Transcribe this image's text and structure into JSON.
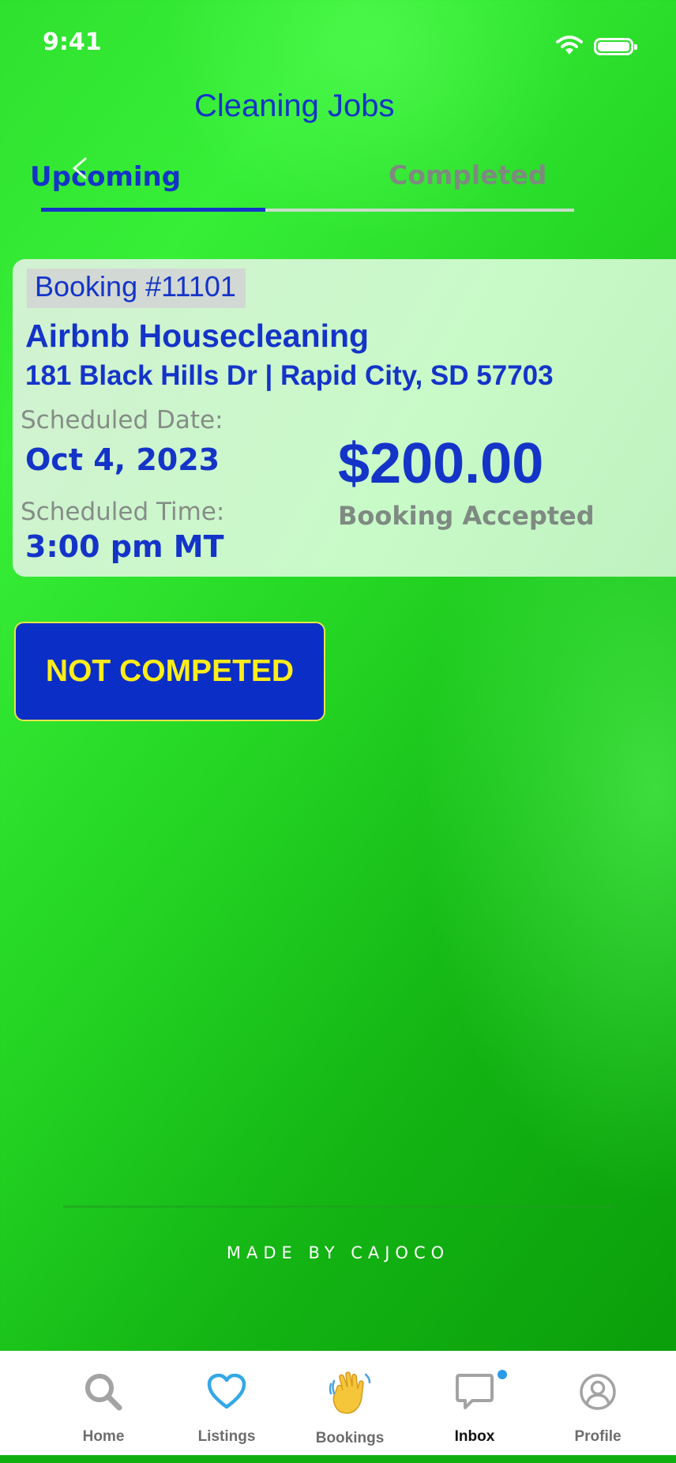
{
  "status_bar": {
    "time": "9:41",
    "icons": [
      "wifi-icon",
      "battery-icon"
    ]
  },
  "header": {
    "title": "Cleaning Jobs"
  },
  "tabs": [
    {
      "label": "Upcoming",
      "active": true
    },
    {
      "label": "Completed",
      "active": false
    }
  ],
  "booking": {
    "id_label": "Booking #11101",
    "title": "Airbnb Housecleaning",
    "address": "181 Black Hills Dr | Rapid City, SD 57703",
    "date_label": "Scheduled Date:",
    "date_value": "Oct 4, 2023",
    "time_label": "Scheduled Time:",
    "time_value": "3:00 pm MT",
    "price": "$200.00",
    "status": "Booking Accepted"
  },
  "status_button": {
    "label": "NOT COMPETED"
  },
  "footer": {
    "credit": "MADE BY CAJOCO"
  },
  "bottom_nav": [
    {
      "label": "Home",
      "icon": "search-icon",
      "active": false
    },
    {
      "label": "Listings",
      "icon": "heart-icon",
      "active": false
    },
    {
      "label": "Bookings",
      "icon": "waving-hand-icon",
      "active": false
    },
    {
      "label": "Inbox",
      "icon": "chat-icon",
      "active": true,
      "badge": true
    },
    {
      "label": "Profile",
      "icon": "user-icon",
      "active": false
    }
  ],
  "colors": {
    "accent_blue": "#1434c8",
    "button_yellow": "#ffed1a",
    "background_green": "#25d625",
    "badge_blue": "#2a9be8"
  }
}
